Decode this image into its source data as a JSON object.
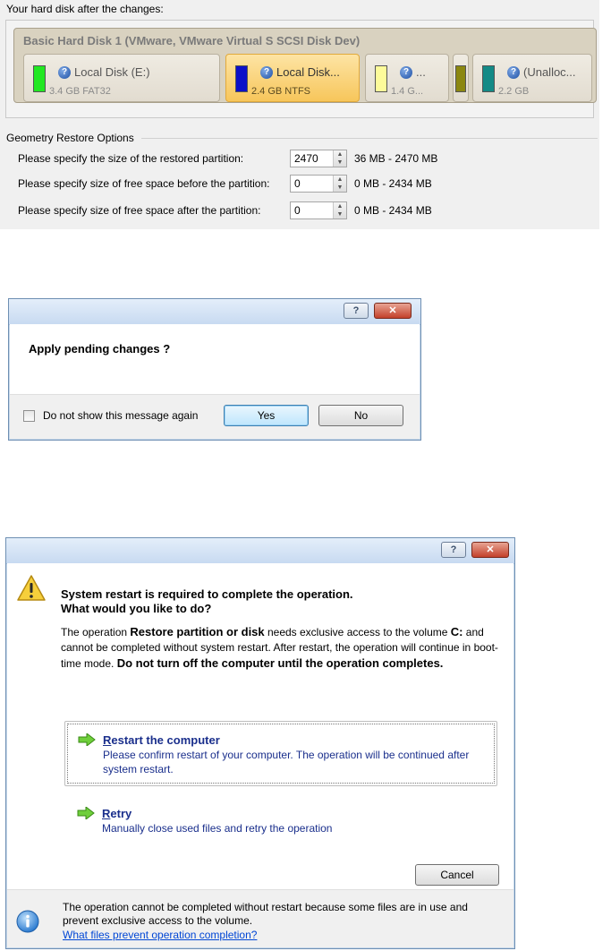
{
  "panel1": {
    "heading": "Your hard disk after the changes:",
    "disk_title": "Basic Hard Disk 1 (VMware, VMware Virtual S SCSI Disk Dev)",
    "partitions": [
      {
        "name": "Local Disk (E:)",
        "info": "3.4 GB FAT32",
        "color": "#22e822"
      },
      {
        "name": "Local Disk...",
        "info": "2.4 GB NTFS",
        "color": "#0c10c8"
      },
      {
        "name": "...",
        "info": "1.4 G...",
        "color": "#fdfb9a"
      },
      {
        "name": "",
        "info": "",
        "color": "#8b8710"
      },
      {
        "name": "(Unalloc...",
        "info": "2.2 GB",
        "color": "#138a86"
      }
    ],
    "geometry_heading": "Geometry Restore Options",
    "rows": [
      {
        "label": "Please specify the size of the restored partition:",
        "value": "2470",
        "range": "36 MB - 2470 MB"
      },
      {
        "label": "Please specify size of free space before the partition:",
        "value": "0",
        "range": "0 MB - 2434 MB"
      },
      {
        "label": "Please specify size of free space after the partition:",
        "value": "0",
        "range": "0 MB - 2434 MB"
      }
    ]
  },
  "dialog2": {
    "message": "Apply pending changes ?",
    "checkbox_label": "Do not show this message again",
    "yes": "Yes",
    "no": "No",
    "help_button": "?"
  },
  "dialog3": {
    "title_line1": "System restart is required to complete the operation.",
    "title_line2": "What would you like to do?",
    "desc_p1": "The operation ",
    "desc_bold1": "Restore partition or disk",
    "desc_p2": " needs exclusive access to the volume ",
    "desc_bold2": "C:",
    "desc_p3": " and cannot be completed without system restart. After restart, the operation will continue in boot-time mode. ",
    "desc_bold3": "Do not turn off the computer until the operation completes.",
    "restart_first": "R",
    "restart_rest": "estart the computer",
    "restart_desc": "Please confirm restart of your computer. The operation will be continued after system restart.",
    "retry_first": "R",
    "retry_rest": "etry",
    "retry_desc": "Manually close used files and retry the operation",
    "cancel": "Cancel",
    "footer_text": "The operation cannot be completed without restart because some files are in use and prevent exclusive access to the volume.",
    "footer_link": "What files prevent operation completion?",
    "help_button": "?"
  }
}
